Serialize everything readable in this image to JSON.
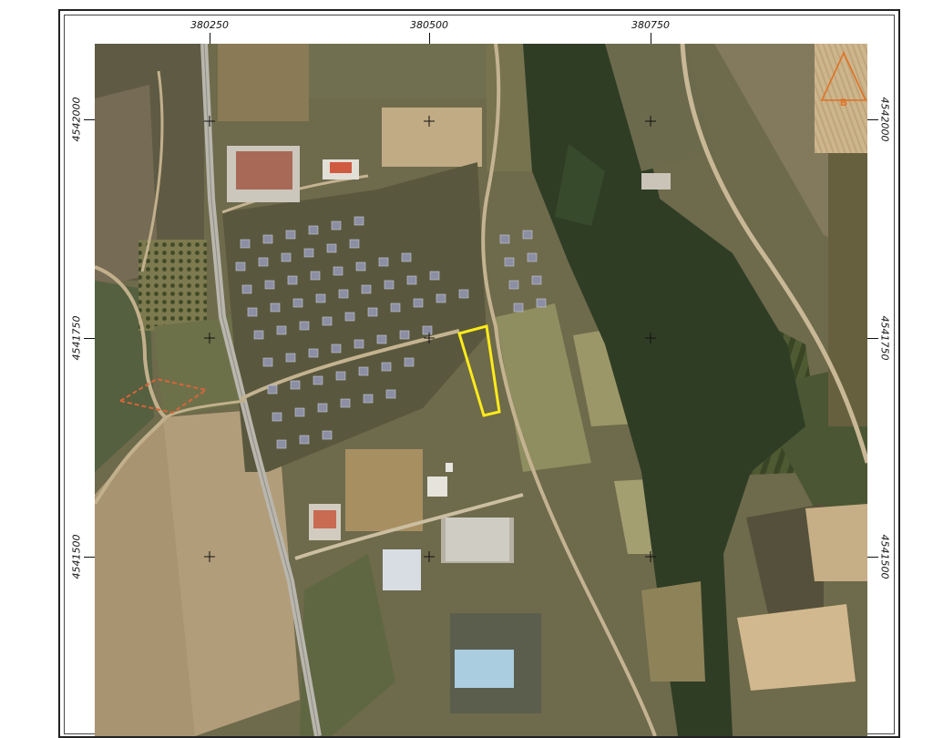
{
  "map": {
    "x_labels": [
      "380250",
      "380500",
      "380750"
    ],
    "y_labels": [
      "4542000",
      "4541750",
      "4541500"
    ],
    "marker_label": "B",
    "colors": {
      "highlight_parcel": "#ffeb1a",
      "dashed_parcel": "#d7643a",
      "marker": "#e07020"
    }
  }
}
